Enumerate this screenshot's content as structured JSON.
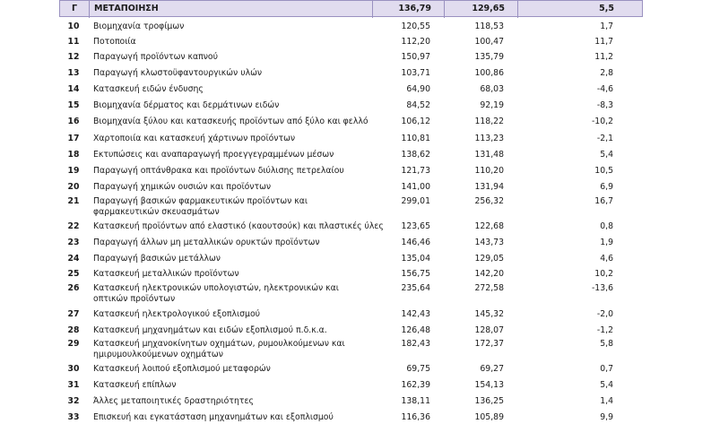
{
  "header": {
    "code": "Γ",
    "name": "ΜΕΤΑΠΟΙΗΣΗ",
    "v1": "136,79",
    "v2": "129,65",
    "v3": "5,5"
  },
  "rows": [
    {
      "code": "10",
      "name": "Βιομηχανία τροφίμων",
      "v1": "120,55",
      "v2": "118,53",
      "v3": "1,7"
    },
    {
      "code": "11",
      "name": "Ποτοποιία",
      "v1": "112,20",
      "v2": "100,47",
      "v3": "11,7"
    },
    {
      "code": "12",
      "name": "Παραγωγή προϊόντων καπνού",
      "v1": "150,97",
      "v2": "135,79",
      "v3": "11,2"
    },
    {
      "code": "13",
      "name": "Παραγωγή κλωστοϋφαντουργικών υλών",
      "v1": "103,71",
      "v2": "100,86",
      "v3": "2,8"
    },
    {
      "code": "14",
      "name": "Κατασκευή ειδών ένδυσης",
      "v1": "64,90",
      "v2": "68,03",
      "v3": "-4,6"
    },
    {
      "code": "15",
      "name": "Βιομηχανία δέρματος και δερμάτινων ειδών",
      "v1": "84,52",
      "v2": "92,19",
      "v3": "-8,3"
    },
    {
      "code": "16",
      "name": "Βιομηχανία ξύλου και κατασκευής προϊόντων από ξύλο και φελλό",
      "v1": "106,12",
      "v2": "118,22",
      "v3": "-10,2"
    },
    {
      "code": "17",
      "name": "Χαρτοποιία και κατασκευή χάρτινων προϊόντων",
      "v1": "110,81",
      "v2": "113,23",
      "v3": "-2,1"
    },
    {
      "code": "18",
      "name": "Εκτυπώσεις και αναπαραγωγή προεγγεγραμμένων μέσων",
      "v1": "138,62",
      "v2": "131,48",
      "v3": "5,4"
    },
    {
      "code": "19",
      "name": "Παραγωγή οπτάνθρακα και προϊόντων διύλισης πετρελαίου",
      "v1": "121,73",
      "v2": "110,20",
      "v3": "10,5"
    },
    {
      "code": "20",
      "name": "Παραγωγή χημικών ουσιών και προϊόντων",
      "v1": "141,00",
      "v2": "131,94",
      "v3": "6,9"
    },
    {
      "code": "21",
      "name": "Παραγωγή βασικών φαρμακευτικών προϊόντων και φαρμακευτικών σκευασμάτων",
      "v1": "299,01",
      "v2": "256,32",
      "v3": "16,7"
    },
    {
      "code": "22",
      "name": "Κατασκευή προϊόντων από ελαστικό (καουτσούκ) και πλαστικές ύλες",
      "v1": "123,65",
      "v2": "122,68",
      "v3": "0,8"
    },
    {
      "code": "23",
      "name": "Παραγωγή άλλων μη μεταλλικών ορυκτών προϊόντων",
      "v1": "146,46",
      "v2": "143,73",
      "v3": "1,9"
    },
    {
      "code": "24",
      "name": "Παραγωγή βασικών μετάλλων",
      "v1": "135,04",
      "v2": "129,05",
      "v3": "4,6"
    },
    {
      "code": "25",
      "name": "Κατασκευή μεταλλικών προϊόντων",
      "v1": "156,75",
      "v2": "142,20",
      "v3": "10,2"
    },
    {
      "code": "26",
      "name": "Κατασκευή ηλεκτρονικών υπολογιστών, ηλεκτρονικών και οπτικών προϊόντων",
      "v1": "235,64",
      "v2": "272,58",
      "v3": "-13,6"
    },
    {
      "code": "27",
      "name": "Κατασκευή ηλεκτρολογικού εξοπλισμού",
      "v1": "142,43",
      "v2": "145,32",
      "v3": "-2,0"
    },
    {
      "code": "28",
      "name": "Κατασκευή μηχανημάτων και ειδών εξοπλισμού π.δ.κ.α.",
      "v1": "126,48",
      "v2": "128,07",
      "v3": "-1,2"
    },
    {
      "code": "29",
      "name": "Κατασκευή μηχανοκίνητων οχημάτων, ρυμουλκούμενων και ημιρυμουλκούμενων οχημάτων",
      "v1": "182,43",
      "v2": "172,37",
      "v3": "5,8"
    },
    {
      "code": "30",
      "name": "Κατασκευή λοιπού εξοπλισμού μεταφορών",
      "v1": "69,75",
      "v2": "69,27",
      "v3": "0,7"
    },
    {
      "code": "31",
      "name": "Κατασκευή επίπλων",
      "v1": "162,39",
      "v2": "154,13",
      "v3": "5,4"
    },
    {
      "code": "32",
      "name": "Άλλες μεταποιητικές δραστηριότητες",
      "v1": "138,11",
      "v2": "136,25",
      "v3": "1,4"
    },
    {
      "code": "33",
      "name": "Επισκευή και εγκατάσταση μηχανημάτων και εξοπλισμού",
      "v1": "116,36",
      "v2": "105,89",
      "v3": "9,9"
    }
  ]
}
